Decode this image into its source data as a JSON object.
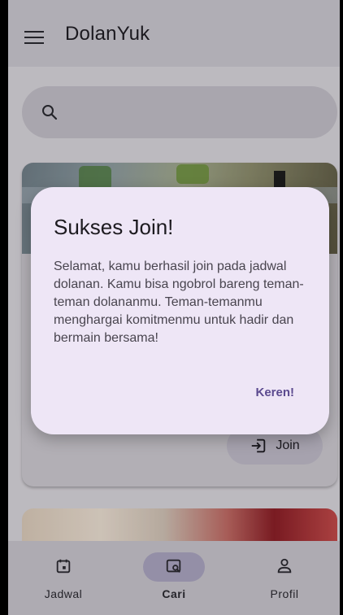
{
  "app": {
    "title": "DolanYuk"
  },
  "search": {
    "placeholder": "",
    "value": ""
  },
  "card": {
    "join_label": "Join"
  },
  "dialog": {
    "title": "Sukses Join!",
    "body": "Selamat, kamu berhasil join pada jadwal dolanan. Kamu bisa ngobrol bareng teman-teman dolananmu. Teman-temanmu menghargai komitmenmu untuk hadir dan bermain bersama!",
    "action_label": "Keren!"
  },
  "bottom_nav": {
    "items": [
      {
        "label": "Jadwal",
        "icon": "calendar-icon",
        "active": false
      },
      {
        "label": "Cari",
        "icon": "search-image-icon",
        "active": true
      },
      {
        "label": "Profil",
        "icon": "person-icon",
        "active": false
      }
    ]
  },
  "colors": {
    "accent": "#5b4a8f",
    "dialog_bg": "#eee6f6",
    "active_pill": "#a9a3bf"
  }
}
